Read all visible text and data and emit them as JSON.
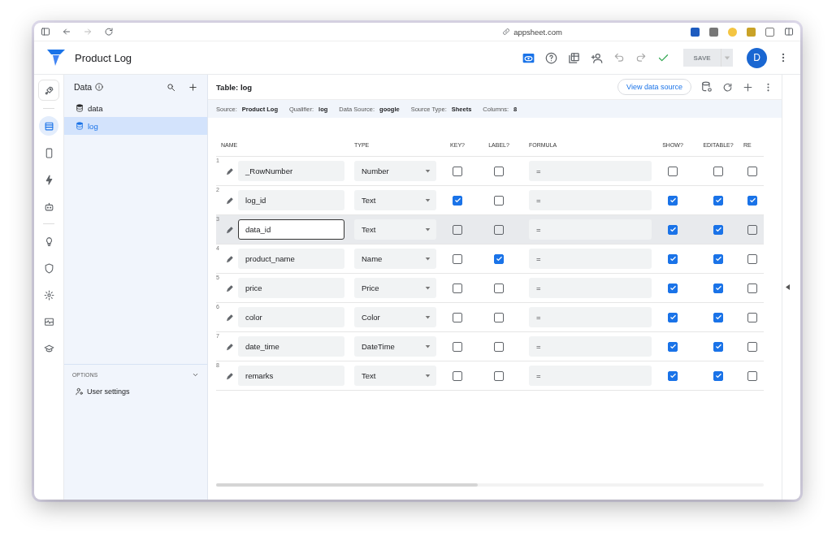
{
  "browser": {
    "url": "appsheet.com"
  },
  "app": {
    "title": "Product Log",
    "save": {
      "label": "SAVE",
      "disabled": true
    },
    "avatar": "D"
  },
  "rail_items": [
    {
      "selected": false
    },
    {
      "selected": true
    },
    {
      "selected": false
    },
    {
      "selected": false
    },
    {
      "selected": false
    },
    {
      "selected": false
    },
    {
      "selected": false
    },
    {
      "selected": false
    },
    {
      "selected": false
    },
    {
      "selected": false
    }
  ],
  "data_panel": {
    "title": "Data",
    "tables": [
      {
        "name": "data",
        "selected": false
      },
      {
        "name": "log",
        "selected": true
      }
    ],
    "options_title": "OPTIONS",
    "options": [
      {
        "label": "User settings"
      }
    ]
  },
  "table": {
    "title": "Table: log",
    "view_source": "View data source",
    "meta": [
      {
        "label": "Source:",
        "value": "Product Log"
      },
      {
        "label": "Qualifier:",
        "value": "log"
      },
      {
        "label": "Data Source:",
        "value": "google"
      },
      {
        "label": "Source Type:",
        "value": "Sheets"
      },
      {
        "label": "Columns:",
        "value": "8"
      }
    ],
    "columns": [
      "NAME",
      "TYPE",
      "KEY?",
      "LABEL?",
      "FORMULA",
      "SHOW?",
      "EDITABLE?",
      "RE"
    ],
    "rows": [
      {
        "number": "1",
        "name": "_RowNumber",
        "type": "Number",
        "key": false,
        "label": false,
        "formula": "=",
        "show": false,
        "editable": false,
        "column_8": false,
        "selected": false
      },
      {
        "number": "2",
        "name": "log_id",
        "type": "Text",
        "key": true,
        "label": false,
        "formula": "=",
        "show": true,
        "editable": true,
        "column_8": true,
        "selected": false
      },
      {
        "number": "3",
        "name": "data_id",
        "type": "Text",
        "key": false,
        "label": false,
        "formula": "=",
        "show": true,
        "editable": true,
        "column_8": false,
        "selected": true
      },
      {
        "number": "4",
        "name": "product_name",
        "type": "Name",
        "key": false,
        "label": true,
        "formula": "=",
        "show": true,
        "editable": true,
        "column_8": false,
        "selected": false
      },
      {
        "number": "5",
        "name": "price",
        "type": "Price",
        "key": false,
        "label": false,
        "formula": "=",
        "show": true,
        "editable": true,
        "column_8": false,
        "selected": false
      },
      {
        "number": "6",
        "name": "color",
        "type": "Color",
        "key": false,
        "label": false,
        "formula": "=",
        "show": true,
        "editable": true,
        "column_8": false,
        "selected": false
      },
      {
        "number": "7",
        "name": "date_time",
        "type": "DateTime",
        "key": false,
        "label": false,
        "formula": "=",
        "show": true,
        "editable": true,
        "column_8": false,
        "selected": false
      },
      {
        "number": "8",
        "name": "remarks",
        "type": "Text",
        "key": false,
        "label": false,
        "formula": "=",
        "show": true,
        "editable": true,
        "column_8": false,
        "selected": false
      }
    ]
  }
}
